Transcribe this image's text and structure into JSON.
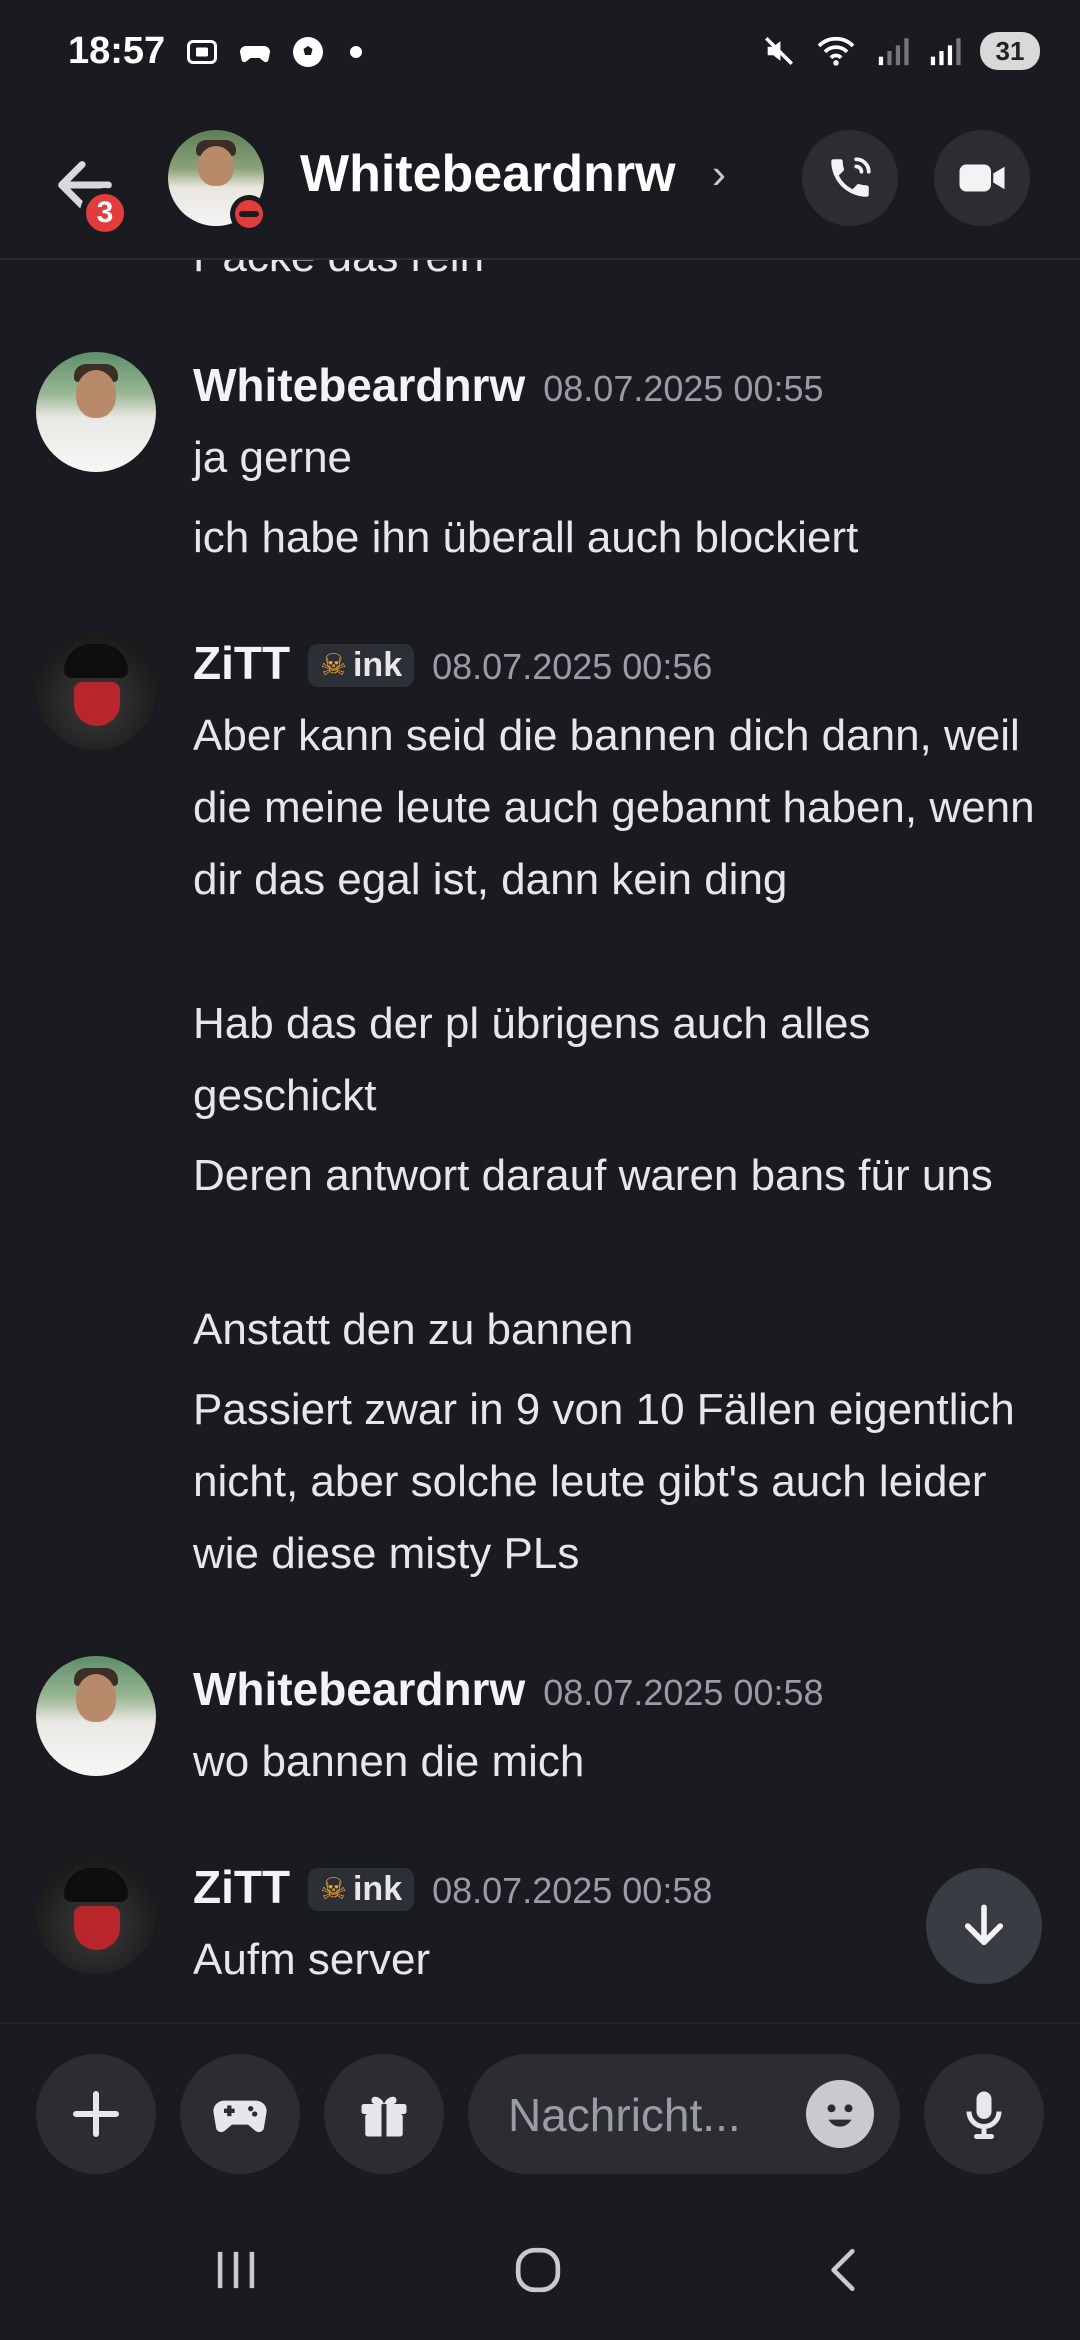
{
  "status_bar": {
    "time": "18:57",
    "battery": "31",
    "icons_left": [
      "screenshot-icon",
      "game-controller-icon",
      "soccer-ball-icon",
      "notification-dot"
    ],
    "icons_right": [
      "mute-icon",
      "wifi-icon",
      "signal-icon",
      "signal-icon",
      "battery-icon"
    ]
  },
  "header": {
    "back_badge": "3",
    "title": "Whitebeardnrw",
    "chevron": "›"
  },
  "partial_message": "Packe das rein",
  "messages": [
    {
      "user": "Whitebeardnrw",
      "timestamp": "08.07.2025 00:55",
      "lines": [
        "ja gerne",
        "ich habe ihn überall auch blockiert"
      ]
    },
    {
      "user": "ZiTT",
      "tag": "ink",
      "timestamp": "08.07.2025 00:56",
      "lines": [
        "Aber kann seid die bannen dich dann, weil die meine leute auch gebannt haben, wenn dir das egal ist, dann kein ding",
        "Hab das der pl übrigens auch alles geschickt",
        "Deren antwort darauf waren bans für uns",
        "Anstatt den zu bannen",
        "Passiert zwar in 9 von 10 Fällen eigentlich nicht, aber solche leute gibt's auch leider wie diese misty PLs"
      ]
    },
    {
      "user": "Whitebeardnrw",
      "timestamp": "08.07.2025 00:58",
      "lines": [
        "wo bannen die mich"
      ]
    },
    {
      "user": "ZiTT",
      "tag": "ink",
      "timestamp": "08.07.2025 00:58",
      "lines": [
        "Aufm server"
      ]
    }
  ],
  "composer": {
    "placeholder": "Nachricht..."
  },
  "colors": {
    "background": "#1a1b21",
    "surface": "#2b2d33",
    "text": "#e6e7eb",
    "muted": "#9a9ca3",
    "badge": "#e23c3c"
  }
}
